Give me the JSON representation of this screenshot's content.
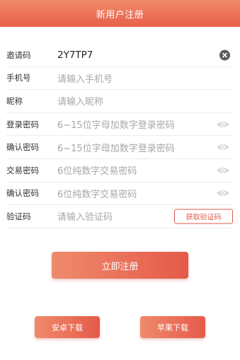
{
  "header": {
    "title": "新用户注册"
  },
  "form": {
    "invite": {
      "label": "邀请码",
      "value": "2Y7TP7",
      "clear_icon": "close-circle-icon"
    },
    "phone": {
      "label": "手机号",
      "placeholder": "请输入手机号"
    },
    "nickname": {
      "label": "昵称",
      "placeholder": "请输入昵称"
    },
    "login_password": {
      "label": "登录密码",
      "placeholder": "6~15位字母加数字登录密码",
      "eye_icon": "eye-icon"
    },
    "confirm_login_password": {
      "label": "确认密码",
      "placeholder": "6~15位字母加数字登录密码",
      "eye_icon": "eye-icon"
    },
    "trade_password": {
      "label": "交易密码",
      "placeholder": "6位纯数字交易密码",
      "eye_icon": "eye-icon"
    },
    "confirm_trade_password": {
      "label": "确认密码",
      "placeholder": "6位纯数字交易密码",
      "eye_icon": "eye-icon"
    },
    "captcha": {
      "label": "验证码",
      "placeholder": "请输入验证码",
      "button": "获取验证码"
    }
  },
  "actions": {
    "submit": "立即注册",
    "android_download": "安卓下载",
    "ios_download": "苹果下载"
  },
  "colors": {
    "header_gradient_top": "#f08a6a",
    "header_gradient_bottom": "#e9604a",
    "accent": "#e0584a",
    "placeholder": "#a7a7a7",
    "divider": "#ececec"
  }
}
